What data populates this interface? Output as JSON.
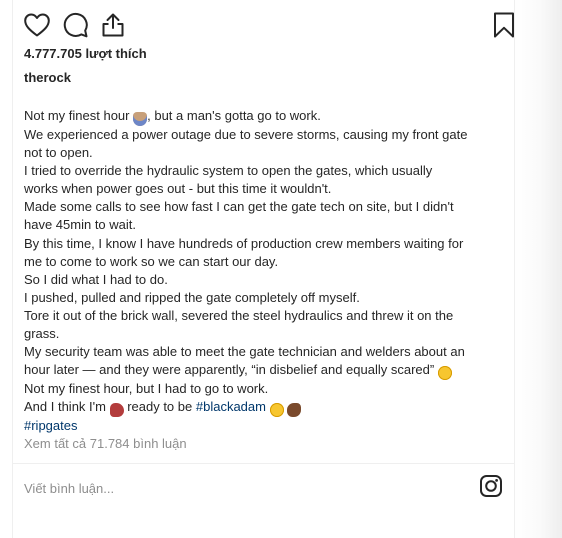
{
  "post": {
    "likes": "4.777.705 lượt thích",
    "username": "therock",
    "caption": {
      "l1a": "Not my finest hour ",
      "l1b": ", but a man's gotta go to work.",
      "l2": "We experienced a power outage due to severe storms, causing my front gate",
      "l3": "not to open.",
      "l4": "I tried to override the hydraulic system to open the gates, which usually",
      "l5": "works when power goes out - but this time it wouldn't.",
      "l6": "Made some calls to see how fast I can get the gate tech on site, but I didn't",
      "l7": "have 45min to wait.",
      "l8": "By this time, I know I have hundreds of production crew members waiting for",
      "l9": "me to come to work so we can start our day.",
      "l10": "So I did what I had to do.",
      "l11": "I pushed, pulled and ripped the gate completely off myself.",
      "l12": "Tore it out of the brick wall, severed the steel hydraulics and threw it on the",
      "l13": "grass.",
      "l14": "My security team was able to meet the gate technician and welders about an",
      "l15a": "hour later — and they were apparently, “in disbelief and equally scared” ",
      "l16": "Not my finest hour, but I had to go to work.",
      "l17a": "And I think I'm ",
      "l17b": " ready to be ",
      "l17c": "#blackadam",
      "l18": "#ripgates"
    },
    "view_comments": "Xem tất cả 71.784 bình luận"
  },
  "comment": {
    "placeholder": "Viết bình luận..."
  },
  "icons": {
    "like": "heart-icon",
    "comment": "comment-bubble-icon",
    "share": "share-icon",
    "save": "bookmark-icon",
    "app": "instagram-icon"
  },
  "colors": {
    "text": "#262626",
    "muted": "#8e8e8e",
    "hashtag": "#00376b",
    "divider": "#efefef"
  }
}
